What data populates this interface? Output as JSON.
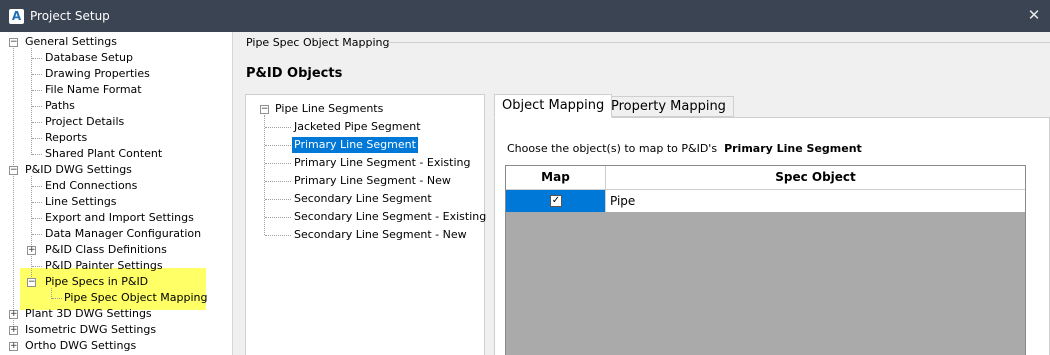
{
  "window": {
    "title": "Project Setup",
    "app_icon_letter": "A",
    "close_glyph": "✕"
  },
  "left_tree": {
    "items": [
      {
        "label": "General Settings"
      },
      {
        "label": "Database Setup"
      },
      {
        "label": "Drawing Properties"
      },
      {
        "label": "File Name Format"
      },
      {
        "label": "Paths"
      },
      {
        "label": "Project Details"
      },
      {
        "label": "Reports"
      },
      {
        "label": "Shared Plant Content"
      },
      {
        "label": "P&ID DWG Settings"
      },
      {
        "label": "End Connections"
      },
      {
        "label": "Line Settings"
      },
      {
        "label": "Export and Import Settings"
      },
      {
        "label": "Data Manager Configuration"
      },
      {
        "label": "P&ID Class Definitions"
      },
      {
        "label": "P&ID Painter Settings"
      },
      {
        "label": "Pipe Specs in P&ID"
      },
      {
        "label": "Pipe Spec Object Mapping"
      },
      {
        "label": "Plant 3D DWG Settings"
      },
      {
        "label": "Isometric DWG Settings"
      },
      {
        "label": "Ortho DWG Settings"
      }
    ],
    "highlight_color": "#ffff66"
  },
  "page": {
    "section_label": "Pipe Spec Object Mapping",
    "objects_heading": "P&ID Objects"
  },
  "mid_tree": {
    "root": "Pipe Line Segments",
    "items": [
      "Jacketed Pipe Segment",
      "Primary Line Segment",
      "Primary Line Segment - Existing",
      "Primary Line Segment - New",
      "Secondary Line Segment",
      "Secondary Line Segment - Existing",
      "Secondary Line Segment - New"
    ],
    "selected": "Primary Line Segment"
  },
  "tabs": {
    "object_mapping": "Object Mapping",
    "property_mapping": "Property Mapping",
    "active": "Object Mapping"
  },
  "mapping": {
    "choose_prefix": "Choose the object(s) to map to P&ID's",
    "choose_target": "Primary Line Segment",
    "columns": {
      "map": "Map",
      "spec_object": "Spec Object"
    },
    "rows": [
      {
        "map_checked": true,
        "check_glyph": "✓",
        "spec_object": "Pipe"
      }
    ]
  },
  "colors": {
    "titlebar": "#3b4453",
    "selection": "#0078d7",
    "grid_empty": "#aaaaaa"
  }
}
